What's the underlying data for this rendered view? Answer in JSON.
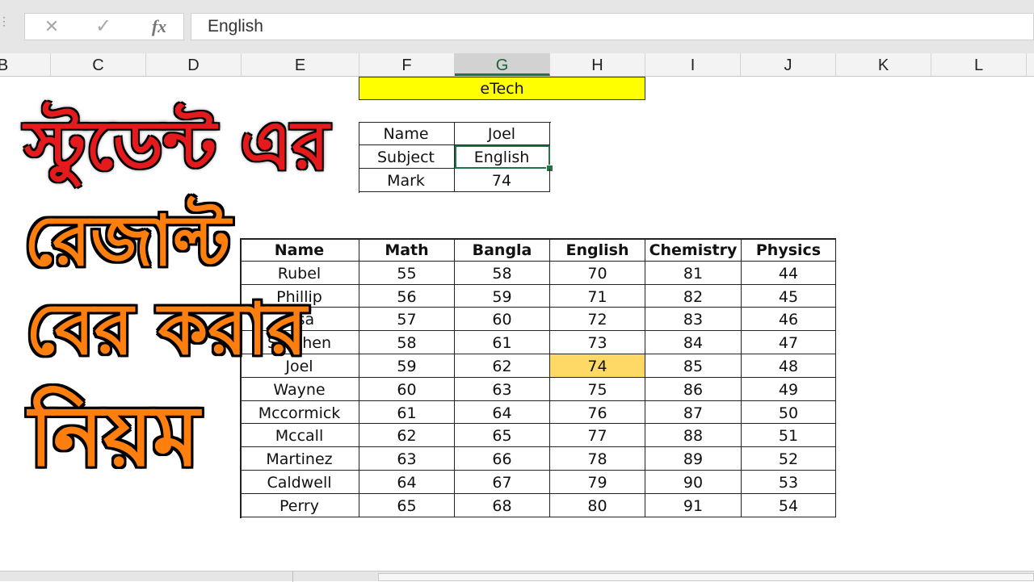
{
  "formula_bar": {
    "cancel_icon": "✕",
    "enter_icon": "✓",
    "fx_label": "fx",
    "value": "English"
  },
  "columns": [
    "B",
    "C",
    "D",
    "E",
    "F",
    "G",
    "H",
    "I",
    "J",
    "K",
    "L"
  ],
  "active_column": "G",
  "banner": {
    "text": "eTech",
    "color": "#ffff00"
  },
  "lookup": {
    "rows": [
      {
        "label": "Name",
        "value": "Joel"
      },
      {
        "label": "Subject",
        "value": "English"
      },
      {
        "label": "Mark",
        "value": "74"
      }
    ]
  },
  "title_lines": [
    "স্টুডেন্ট এর",
    "রেজাল্ট",
    "বের করার",
    "নিয়ম"
  ],
  "table": {
    "headers": [
      "Name",
      "Math",
      "Bangla",
      "English",
      "Chemistry",
      "Physics"
    ],
    "rows": [
      [
        "Rubel",
        "55",
        "58",
        "70",
        "81",
        "44"
      ],
      [
        "Phillip",
        "56",
        "59",
        "71",
        "82",
        "45"
      ],
      [
        "Lisa",
        "57",
        "60",
        "72",
        "83",
        "46"
      ],
      [
        "Stephen",
        "58",
        "61",
        "73",
        "84",
        "47"
      ],
      [
        "Joel",
        "59",
        "62",
        "74",
        "85",
        "48"
      ],
      [
        "Wayne",
        "60",
        "63",
        "75",
        "86",
        "49"
      ],
      [
        "Mccormick",
        "61",
        "64",
        "76",
        "87",
        "50"
      ],
      [
        "Mccall",
        "62",
        "65",
        "77",
        "88",
        "51"
      ],
      [
        "Martinez",
        "63",
        "66",
        "78",
        "89",
        "52"
      ],
      [
        "Caldwell",
        "64",
        "67",
        "79",
        "90",
        "53"
      ],
      [
        "Perry",
        "65",
        "68",
        "80",
        "91",
        "54"
      ]
    ],
    "highlight_color": "#ffd966"
  },
  "colors": {
    "accent": "#217346",
    "title_red": "#e41a1c",
    "title_orange": "#ff7f0e"
  }
}
